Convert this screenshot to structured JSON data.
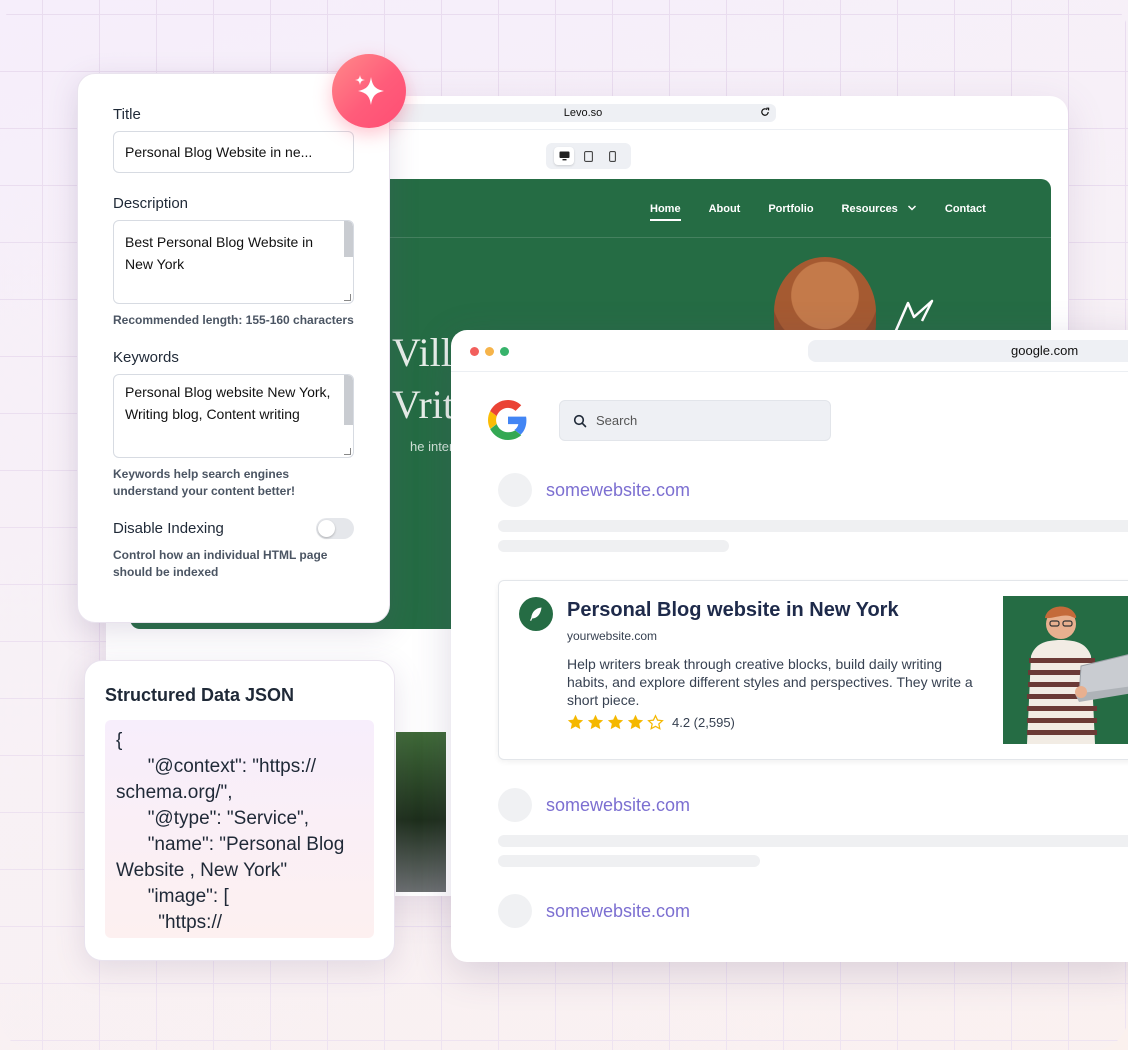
{
  "back_browser": {
    "url": "Levo.so",
    "nav": [
      "Home",
      "About",
      "Portfolio",
      "Resources",
      "Contact"
    ],
    "hero_fragment_line1": "Vill A",
    "hero_fragment_line2": "Vrite",
    "hero_sub_fragment": "he interne"
  },
  "seo_panel": {
    "title_label": "Title",
    "title_value": "Personal Blog Website in ne...",
    "description_label": "Description",
    "description_value": "Best Personal Blog Website in New York",
    "description_hint": "Recommended length: 155-160 characters",
    "keywords_label": "Keywords",
    "keywords_value": "Personal Blog website New York, Writing blog, Content writing",
    "keywords_hint": "Keywords help search engines understand your content better!",
    "indexing_label": "Disable Indexing",
    "indexing_hint": "Control how an individual HTML page should be indexed",
    "indexing_enabled": false
  },
  "json_card": {
    "title": "Structured Data JSON",
    "code": "{\n      \"@context\": \"https://\nschema.org/\",\n      \"@type\": \"Service\",\n      \"name\": \"Personal Blog\nWebsite , New York\"\n      \"image\": [\n        \"https://"
  },
  "google": {
    "url": "google.com",
    "search_placeholder": "Search",
    "results": [
      {
        "link": "somewebsite.com"
      },
      {
        "link": "somewebsite.com"
      },
      {
        "link": "somewebsite.com"
      }
    ],
    "featured": {
      "title": "Personal Blog website in New York",
      "url": "yourwebsite.com",
      "description": "Help writers break through creative blocks, build daily writing habits, and explore different styles and perspectives. They write a short piece.",
      "rating_text": "4.2 (2,595)",
      "stars_filled": 4,
      "stars_total": 5
    }
  },
  "colors": {
    "brand_green": "#256c44",
    "link_purple": "#7c6fd1",
    "star_yellow": "#f5b800",
    "sparkle_pink": "#ff5c7a"
  }
}
